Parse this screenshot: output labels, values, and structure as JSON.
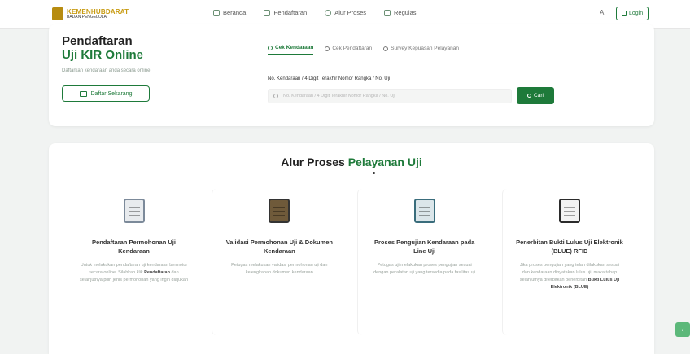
{
  "header": {
    "logo_title": "KEMENHUBDARAT",
    "logo_sub": "BADAN PENGELOLA",
    "nav": [
      {
        "label": "Beranda",
        "icon": "home-icon"
      },
      {
        "label": "Pendaftaran",
        "icon": "list-icon"
      },
      {
        "label": "Alur Proses",
        "icon": "info-icon"
      },
      {
        "label": "Regulasi",
        "icon": "document-icon"
      }
    ],
    "lang": "A",
    "login_label": "Login"
  },
  "hero": {
    "title_line1": "Pendaftaran",
    "title_line2": "Uji KIR Online",
    "description": "Daftarkan kendaraan anda secara online",
    "register_label": "Daftar Sekarang"
  },
  "search": {
    "tabs": [
      "Cek Kendaraan",
      "Cek Pendaftaran",
      "Survey Kepuasan Pelayanan"
    ],
    "label": "No. Kendaraan / 4 Digit Terakhir Nomor Rangka / No. Uji",
    "placeholder": "No. Kendaraan / 4 Digit Terakhir Nomor Rangka / No. Uji",
    "button_label": "Cari"
  },
  "process": {
    "title_main": "Alur Proses",
    "title_accent": "Pelayanan Uji",
    "steps": [
      {
        "title": "Pendaftaran Permohonan Uji Kendaraan",
        "desc": "Untuk melakukan pendaftaran uji kendaraan bermotor secara online. Silahkan klik",
        "desc_bold": "Pendaftaran",
        "desc_tail": "dan selanjutnya pilih jenis permohonan yang ingin diajukan",
        "icon": "form-icon"
      },
      {
        "title": "Validasi Permohonan Uji & Dokumen Kendaraan",
        "desc": "Petugas melakukan validasi permohonan uji dan kelengkapan dokumen kendaraan",
        "icon": "checklist-icon"
      },
      {
        "title": "Proses Pengujian Kendaraan pada Line Uji",
        "desc": "Petugas uji melakukan proses pengujian sesuai dengan peralatan uji yang tersedia pada fasilitas uji",
        "icon": "clipboard-icon"
      },
      {
        "title": "Penerbitan Bukti Lulus Uji Elektronik (BLUE) RFID",
        "desc": "Jika proses pengujian yang telah dilakukan sesuai dan kendaraan dinyatakan lulus uji, maka tahap selanjutnya diterbitkan penerbitan",
        "desc_bold": "Bukti Lulus Uji Elektronik (BLUE)",
        "icon": "certificate-icon"
      }
    ]
  },
  "float_button": "‹"
}
